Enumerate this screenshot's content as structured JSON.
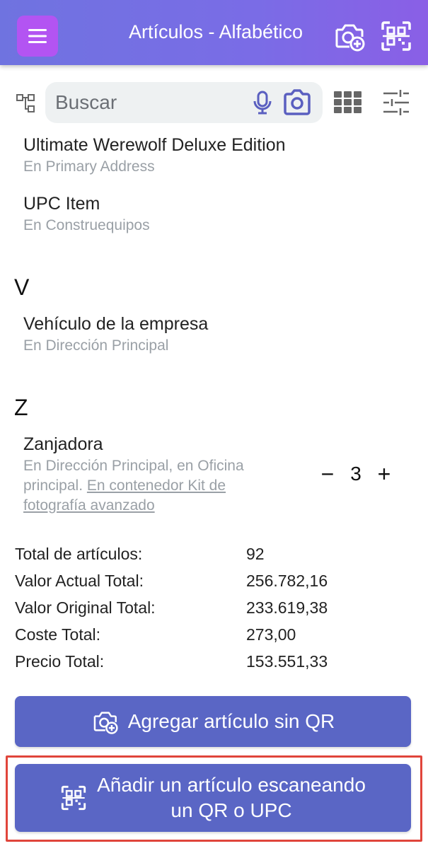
{
  "header": {
    "title": "Artículos - Alfabético",
    "menu_icon": "hamburger-menu-icon",
    "camera_add_icon": "camera-plus-icon",
    "scan_icon": "qr-scan-icon",
    "gradient_start": "#6f73e0",
    "gradient_end": "#8a5fe6",
    "menu_color": "#b354f2"
  },
  "search": {
    "placeholder": "Buscar",
    "value": ""
  },
  "items": [
    {
      "name": "Ultimate Werewolf Deluxe Edition",
      "location": "En Primary Address"
    },
    {
      "name": "UPC Item",
      "location": "En Construequipos"
    }
  ],
  "sections": [
    {
      "letter": "V",
      "items": [
        {
          "name": "Vehículo de la empresa",
          "location": "En Dirección Principal"
        }
      ]
    },
    {
      "letter": "Z",
      "items": [
        {
          "name": "Zanjadora",
          "location_prefix": "En Dirección Principal, en Oficina principal.",
          "location_link": "En contenedor Kit de fotografía avanzado",
          "quantity": "3",
          "minus": "−",
          "plus": "+"
        }
      ]
    }
  ],
  "totals": [
    {
      "label": "Total de artículos:",
      "value": "92"
    },
    {
      "label": "Valor Actual Total:",
      "value": "256.782,16"
    },
    {
      "label": "Valor Original Total:",
      "value": "233.619,38"
    },
    {
      "label": "Coste Total:",
      "value": "273,00"
    },
    {
      "label": "Precio Total:",
      "value": "153.551,33"
    }
  ],
  "buttons": {
    "add_without_qr": "Agregar artículo sin QR",
    "add_by_scan_line1": "Añadir un artículo escaneando",
    "add_by_scan_line2": "un QR o UPC",
    "accent": "#5a66c5",
    "highlight_color": "#e0453b"
  }
}
